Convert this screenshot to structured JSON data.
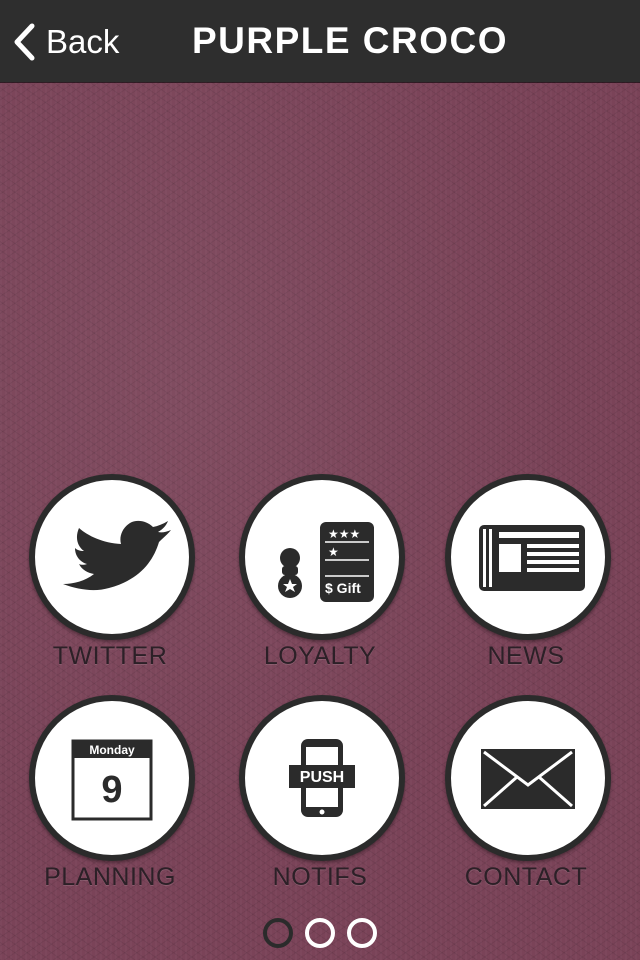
{
  "navbar": {
    "back_label": "Back",
    "title": "PURPLE CROCO"
  },
  "tiles": [
    {
      "label": "TWITTER",
      "icon": "twitter-bird-icon"
    },
    {
      "label": "LOYALTY",
      "icon": "loyalty-card-icon",
      "card_text": "$ Gift"
    },
    {
      "label": "NEWS",
      "icon": "newspaper-icon"
    },
    {
      "label": "PLANNING",
      "icon": "calendar-icon",
      "calendar_day": "Monday",
      "calendar_date": "9"
    },
    {
      "label": "NOTIFS",
      "icon": "push-phone-icon",
      "push_text": "PUSH"
    },
    {
      "label": "CONTACT",
      "icon": "envelope-icon"
    }
  ],
  "pagination": {
    "pages": 3,
    "current": 1
  },
  "colors": {
    "navbar": "#2e2e2e",
    "background": "#7a4358",
    "icon_dark": "#2b2b2b",
    "icon_light": "#ffffff"
  }
}
